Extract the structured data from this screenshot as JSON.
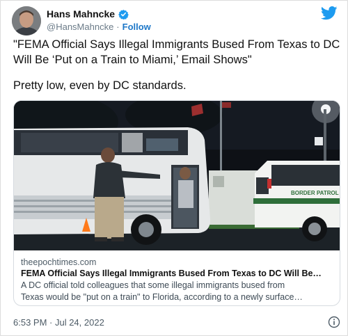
{
  "author": {
    "display_name": "Hans Mahncke",
    "handle": "@HansMahncke",
    "separator": "·",
    "follow_label": "Follow",
    "verified_color": "#1d9bf0"
  },
  "brand": {
    "icon": "twitter-bird-icon",
    "color": "#1d9bf0"
  },
  "tweet": {
    "quote": "\"FEMA Official Says Illegal Immigrants Bused From Texas to DC Will Be ‘Put on a Train to Miami,’ Email Shows\"",
    "comment": "Pretty low, even by DC standards."
  },
  "card": {
    "image_subject": "photo",
    "van_label": "BORDER PATROL",
    "domain": "theepochtimes.com",
    "title": "FEMA Official Says Illegal Immigrants Bused From Texas to DC Will Be…",
    "description_line1": "A DC official told colleagues that some illegal immigrants bused from",
    "description_line2": "Texas would be \"put on a train\" to Florida, according to a newly surface…"
  },
  "footer": {
    "timestamp": "6:53 PM · Jul 24, 2022",
    "info_icon": "info-icon"
  }
}
